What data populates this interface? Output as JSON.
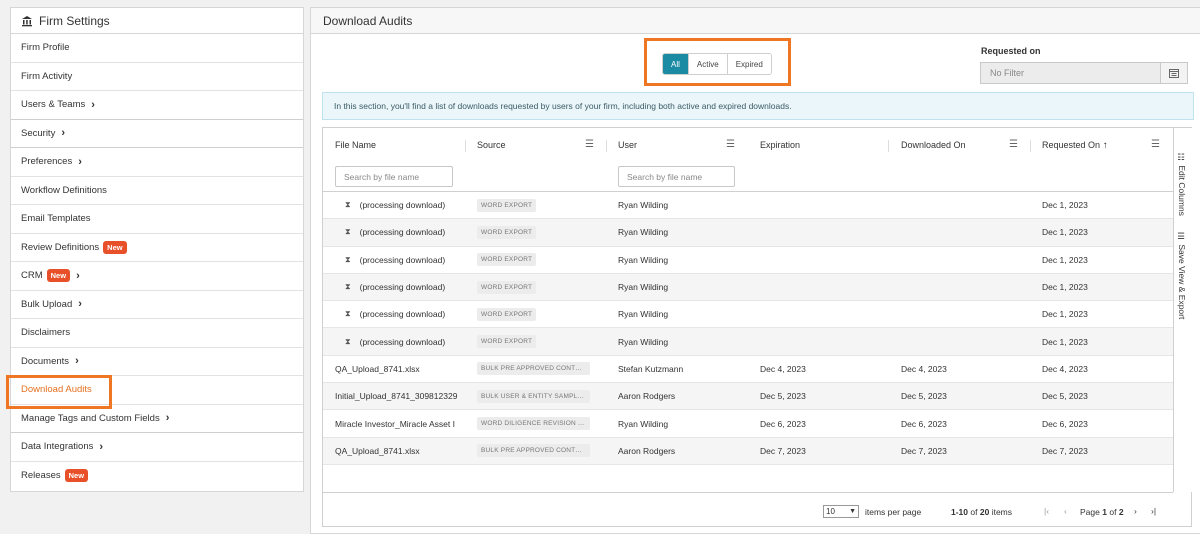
{
  "sidebar": {
    "title": "Firm Settings",
    "items": [
      {
        "label": "Firm Profile"
      },
      {
        "label": "Firm Activity"
      },
      {
        "label": "Users & Teams"
      },
      {
        "label": "Security"
      },
      {
        "label": "Preferences"
      },
      {
        "label": "Workflow Definitions"
      },
      {
        "label": "Email Templates"
      },
      {
        "label": "Review Definitions",
        "badge": "New"
      },
      {
        "label": "CRM",
        "badge": "New"
      },
      {
        "label": "Bulk Upload"
      },
      {
        "label": "Disclaimers"
      },
      {
        "label": "Documents"
      },
      {
        "label": "Download Audits"
      },
      {
        "label": "Manage Tags and Custom Fields"
      },
      {
        "label": "Data Integrations"
      },
      {
        "label": "Releases",
        "badge": "New"
      }
    ]
  },
  "main": {
    "title": "Download Audits",
    "filter": {
      "all": "All",
      "active": "Active",
      "expired": "Expired"
    },
    "requested_on": {
      "label": "Requested on",
      "placeholder": "No Filter"
    },
    "info": "In this section, you'll find a list of downloads requested by users of your firm, including both active and expired downloads."
  },
  "grid": {
    "columns": {
      "file_name": "File Name",
      "source": "Source",
      "user": "User",
      "expiration": "Expiration",
      "downloaded_on": "Downloaded On",
      "requested_on": "Requested On"
    },
    "search_file": "Search by file name",
    "search_user": "Search by file name",
    "rows": [
      {
        "file": "(processing download)",
        "source": "WORD EXPORT",
        "user": "Ryan Wilding",
        "exp": "",
        "dl": "",
        "req": "Dec 1, 2023"
      },
      {
        "file": "(processing download)",
        "source": "WORD EXPORT",
        "user": "Ryan Wilding",
        "exp": "",
        "dl": "",
        "req": "Dec 1, 2023"
      },
      {
        "file": "(processing download)",
        "source": "WORD EXPORT",
        "user": "Ryan Wilding",
        "exp": "",
        "dl": "",
        "req": "Dec 1, 2023"
      },
      {
        "file": "(processing download)",
        "source": "WORD EXPORT",
        "user": "Ryan Wilding",
        "exp": "",
        "dl": "",
        "req": "Dec 1, 2023"
      },
      {
        "file": "(processing download)",
        "source": "WORD EXPORT",
        "user": "Ryan Wilding",
        "exp": "",
        "dl": "",
        "req": "Dec 1, 2023"
      },
      {
        "file": "(processing download)",
        "source": "WORD EXPORT",
        "user": "Ryan Wilding",
        "exp": "",
        "dl": "",
        "req": "Dec 1, 2023"
      },
      {
        "file": "QA_Upload_8741.xlsx",
        "source": "BULK PRE APPROVED CONTEN...",
        "user": "Stefan Kutzmann",
        "exp": "Dec 4, 2023",
        "dl": "Dec 4, 2023",
        "req": "Dec 4, 2023"
      },
      {
        "file": "Initial_Upload_8741_309812329",
        "source": "BULK USER & ENTITY SAMPLE F...",
        "user": "Aaron Rodgers",
        "exp": "Dec 5, 2023",
        "dl": "Dec 5, 2023",
        "req": "Dec 5, 2023"
      },
      {
        "file": "Miracle Investor_Miracle Asset I",
        "source": "WORD DILIGENCE REVISION EX...",
        "user": "Ryan Wilding",
        "exp": "Dec 6, 2023",
        "dl": "Dec 6, 2023",
        "req": "Dec 6, 2023"
      },
      {
        "file": "QA_Upload_8741.xlsx",
        "source": "BULK PRE APPROVED CONTEN...",
        "user": "Aaron Rodgers",
        "exp": "Dec 7, 2023",
        "dl": "Dec 7, 2023",
        "req": "Dec 7, 2023"
      }
    ],
    "side": {
      "edit_columns": "Edit Columns",
      "save_view": "Save View & Export"
    },
    "footer": {
      "page_size": "10",
      "per_page": "items per page",
      "range": "1-10",
      "of": "of",
      "total": "20",
      "items": "items",
      "page_label": "Page",
      "page": "1",
      "pages": "2"
    }
  },
  "colors": {
    "accent": "#1b8aa3",
    "highlight": "#ef7622",
    "badge": "#e8502a"
  }
}
